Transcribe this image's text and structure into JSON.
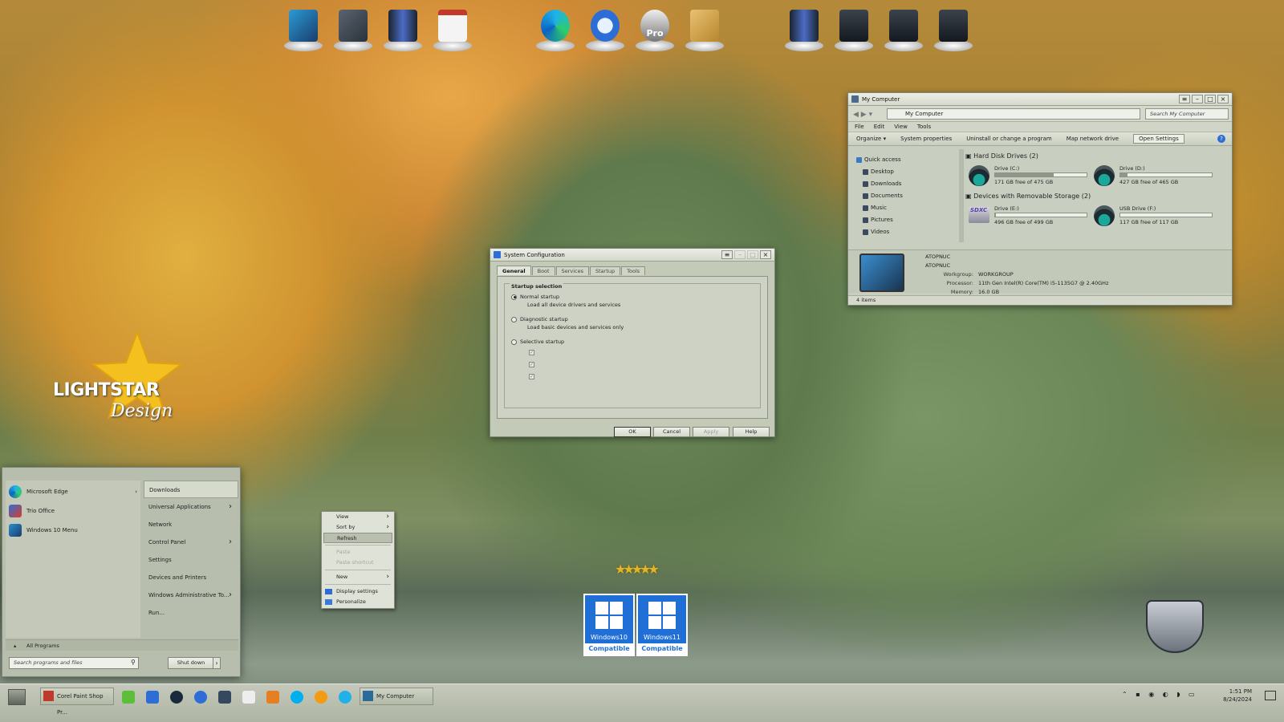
{
  "dock": {
    "items": [
      "computer-icon",
      "documents-icon",
      "server-icon",
      "checklist-icon",
      "edge-icon",
      "thunderbird-icon",
      "pro-icon",
      "contacts-icon",
      "server-icon",
      "drive-icon",
      "drive-icon",
      "drive-icon"
    ],
    "pro_label": "Pro"
  },
  "branding": {
    "logo_main": "LIGHTSTAR",
    "logo_sub": "Design"
  },
  "explorer": {
    "title": "My Computer",
    "address": "My Computer",
    "search_placeholder": "Search My Computer",
    "menu": [
      "File",
      "Edit",
      "View",
      "Tools"
    ],
    "commands": [
      "Organize",
      "System properties",
      "Uninstall or change a program",
      "Map network drive",
      "Open Settings"
    ],
    "nav": [
      "Quick access",
      "Desktop",
      "Downloads",
      "Documents",
      "Music",
      "Pictures",
      "Videos"
    ],
    "section_hdd": "Hard Disk Drives (2)",
    "section_removable": "Devices with Removable Storage (2)",
    "drives": [
      {
        "name": "Drive (C:)",
        "free": "171 GB free of 475 GB",
        "used_fraction": 0.64
      },
      {
        "name": "Drive (D:)",
        "free": "427 GB free of 465 GB",
        "used_fraction": 0.08
      },
      {
        "name": "Drive (E:)",
        "free": "496 GB free of 499 GB",
        "used_fraction": 0.01
      },
      {
        "name": "USB Drive (F:)",
        "free": "117 GB free of 117 GB",
        "used_fraction": 0.0
      }
    ],
    "sdxc_label": "SDXC",
    "details": {
      "name1": "ATOPNUC",
      "name2": "ATOPNUC",
      "workgroup_label": "Workgroup:",
      "workgroup": "WORKGROUP",
      "processor_label": "Processor:",
      "processor": "11th Gen Intel(R) Core(TM) i5-1135G7 @ 2.40GHz",
      "memory_label": "Memory:",
      "memory": "16.0 GB"
    },
    "status": "4 items"
  },
  "msconfig": {
    "title": "System Configuration",
    "tabs": [
      "General",
      "Boot",
      "Services",
      "Startup",
      "Tools"
    ],
    "group_title": "Startup selection",
    "normal": "Normal startup",
    "normal_desc": "Load all device drivers and services",
    "diagnostic": "Diagnostic startup",
    "diagnostic_desc": "Load basic devices and services only",
    "selective": "Selective startup",
    "buttons": {
      "ok": "OK",
      "cancel": "Cancel",
      "apply": "Apply",
      "help": "Help"
    }
  },
  "startmenu": {
    "programs": [
      "Microsoft Edge",
      "Trio Office",
      "Windows 10 Menu"
    ],
    "right": [
      "Downloads",
      "Universal Applications",
      "Network",
      "Control Panel",
      "Settings",
      "Devices and Printers",
      "Windows Administrative To...",
      "Run..."
    ],
    "all_programs": "All Programs",
    "search_placeholder": "Search programs and files",
    "shutdown": "Shut down"
  },
  "context_menu": {
    "items": [
      "View",
      "Sort by",
      "Refresh",
      "Paste",
      "Paste shortcut",
      "New",
      "Display settings",
      "Personalize"
    ]
  },
  "badges": [
    {
      "name": "Windows10",
      "caption": "Compatible"
    },
    {
      "name": "Windows11",
      "caption": "Compatible"
    }
  ],
  "taskbar": {
    "app1": "Corel Paint Shop Pr...",
    "app2": "My Computer",
    "time": "1:51 PM",
    "date": "8/24/2024"
  }
}
